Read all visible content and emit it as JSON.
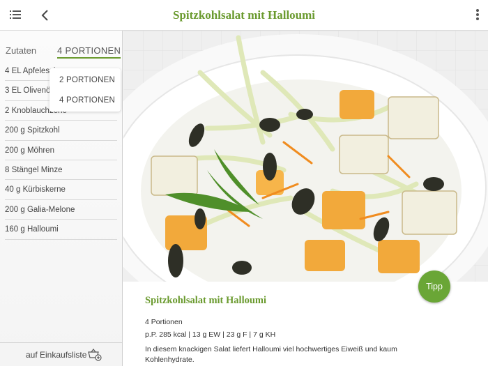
{
  "header": {
    "title": "Spitzkohlsalat mit Halloumi",
    "menu_icon": "hamburger-menu-icon",
    "back_icon": "chevron-left-icon",
    "more_icon": "vertical-dots-icon"
  },
  "sidebar": {
    "tab_ingredients": "Zutaten",
    "tab_portions": "4 PORTIONEN",
    "ingredients": [
      "4 EL Apfelessig",
      "3 EL Olivenöl",
      "2 Knoblauchzehe",
      "200 g Spitzkohl",
      "200 g Möhren",
      "8 Stängel Minze",
      "40 g Kürbiskerne",
      "200 g Galia-Melone",
      "160 g Halloumi"
    ],
    "shopping_list_label": "auf Einkaufsliste",
    "shopping_icon": "basket-add-icon"
  },
  "portions_dropdown": {
    "options": [
      "2 PORTIONEN",
      "4 PORTIONEN"
    ]
  },
  "recipe": {
    "title": "Spitzkohlsalat mit Halloumi",
    "servings": "4 Portionen",
    "nutrition": "p.P. 285 kcal | 13 g EW | 23 g F | 7 g KH",
    "description": "In diesem knackigen Salat liefert Halloumi viel hochwertiges Eiweiß und kaum Kohlenhydrate.",
    "tip_label": "Tipp"
  },
  "colors": {
    "accent_green": "#6a9a2e",
    "tip_button": "#6aa636"
  }
}
